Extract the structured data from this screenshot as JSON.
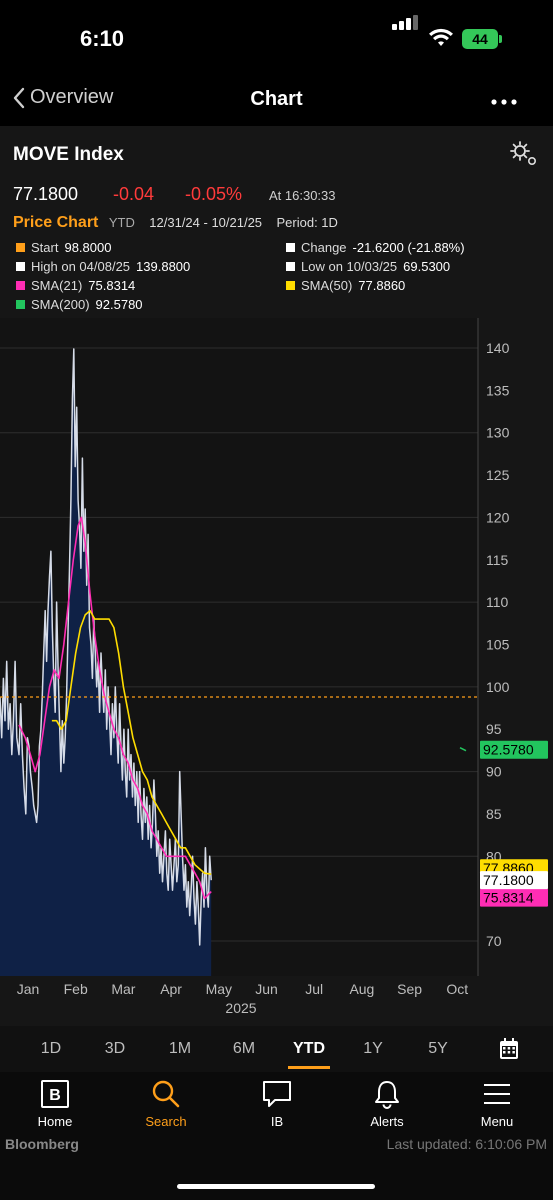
{
  "status_bar": {
    "time": "6:10",
    "battery": "44"
  },
  "nav": {
    "back_label": "Overview",
    "title": "Chart"
  },
  "security": {
    "name": "MOVE Index",
    "last": "77.1800",
    "change": "-0.04",
    "change_pct": "-0.05%",
    "time": "At 16:30:33"
  },
  "price_chart": {
    "title": "Price Chart",
    "range_type": "YTD",
    "date_range": "12/31/24 - 10/21/25",
    "period": "Period: 1D"
  },
  "legend": [
    {
      "label": "Start",
      "value": "98.8000",
      "color": "#ff9f1a"
    },
    {
      "label": "Change",
      "value": "-21.6200 (-21.88%)",
      "color": "#ffffff"
    },
    {
      "label": "High on 04/08/25",
      "value": "139.8800",
      "color": "#ffffff"
    },
    {
      "label": "Low on 10/03/25",
      "value": "69.5300",
      "color": "#ffffff"
    },
    {
      "label": "SMA(21)",
      "value": "75.8314",
      "color": "#ff2db4"
    },
    {
      "label": "SMA(50)",
      "value": "77.8860",
      "color": "#ffdd00"
    },
    {
      "label": "SMA(200)",
      "value": "92.5780",
      "color": "#22c55e"
    }
  ],
  "chart_data": {
    "type": "area",
    "ylim": [
      65,
      142
    ],
    "y_ticks": [
      "70",
      "75",
      "80",
      "85",
      "90",
      "95",
      "100",
      "105",
      "110",
      "115",
      "120",
      "125",
      "130",
      "135",
      "140"
    ],
    "x_ticks": [
      "Jan",
      "Feb",
      "Mar",
      "Apr",
      "May",
      "Jun",
      "Jul",
      "Aug",
      "Sep",
      "Oct"
    ],
    "x_year": "2025",
    "start_line": 98.8,
    "markers": [
      {
        "value": 92.578,
        "label": "92.5780",
        "bg": "#22c55e",
        "fg": "#000000"
      },
      {
        "value": 77.886,
        "label": "77.8860",
        "bg": "#ffdd00",
        "fg": "#000000"
      },
      {
        "value": 75.8314,
        "label": "75.8314",
        "bg": "#ff2db4",
        "fg": "#000000"
      },
      {
        "value": 77.18,
        "label": "77.1800",
        "bg": "#ffffff",
        "fg": "#000000"
      }
    ],
    "series": [
      {
        "name": "MOVE Index",
        "color": "#d6dce8",
        "fill": "#0f2146",
        "points": [
          [
            0,
            98.8
          ],
          [
            0.03,
            94
          ],
          [
            0.06,
            101
          ],
          [
            0.09,
            96
          ],
          [
            0.12,
            103
          ],
          [
            0.15,
            95
          ],
          [
            0.18,
            98
          ],
          [
            0.21,
            92
          ],
          [
            0.24,
            96
          ],
          [
            0.27,
            103
          ],
          [
            0.3,
            94
          ],
          [
            0.34,
            92
          ],
          [
            0.37,
            98
          ],
          [
            0.4,
            92
          ],
          [
            0.43,
            88
          ],
          [
            0.46,
            85
          ],
          [
            0.49,
            94
          ],
          [
            0.52,
            93
          ],
          [
            0.55,
            90
          ],
          [
            0.59,
            88
          ],
          [
            0.62,
            86
          ],
          [
            0.65,
            85
          ],
          [
            0.68,
            84
          ],
          [
            0.71,
            86
          ],
          [
            0.74,
            93
          ],
          [
            0.77,
            95
          ],
          [
            0.8,
            99
          ],
          [
            0.83,
            104
          ],
          [
            0.86,
            109
          ],
          [
            0.89,
            103
          ],
          [
            0.92,
            109
          ],
          [
            0.95,
            113
          ],
          [
            0.98,
            116
          ],
          [
            1.01,
            107
          ],
          [
            1.04,
            101
          ],
          [
            1.07,
            97
          ],
          [
            1.1,
            110
          ],
          [
            1.13,
            102
          ],
          [
            1.16,
            96
          ],
          [
            1.19,
            90
          ],
          [
            1.22,
            96
          ],
          [
            1.25,
            91
          ],
          [
            1.28,
            94
          ],
          [
            1.31,
            99
          ],
          [
            1.34,
            107
          ],
          [
            1.37,
            114
          ],
          [
            1.4,
            122
          ],
          [
            1.43,
            134
          ],
          [
            1.46,
            139.88
          ],
          [
            1.49,
            126
          ],
          [
            1.52,
            133
          ],
          [
            1.55,
            122
          ],
          [
            1.58,
            119
          ],
          [
            1.61,
            114
          ],
          [
            1.64,
            127
          ],
          [
            1.67,
            116
          ],
          [
            1.7,
            121
          ],
          [
            1.73,
            112
          ],
          [
            1.76,
            118
          ],
          [
            1.79,
            107
          ],
          [
            1.82,
            105
          ],
          [
            1.85,
            101
          ],
          [
            1.88,
            108
          ],
          [
            1.91,
            104
          ],
          [
            1.94,
            100
          ],
          [
            1.97,
            103
          ],
          [
            2.0,
            97
          ],
          [
            2.03,
            104
          ],
          [
            2.06,
            100
          ],
          [
            2.09,
            97
          ],
          [
            2.12,
            102
          ],
          [
            2.15,
            95
          ],
          [
            2.18,
            100
          ],
          [
            2.21,
            96
          ],
          [
            2.24,
            92
          ],
          [
            2.27,
            98
          ],
          [
            2.3,
            94
          ],
          [
            2.33,
            100
          ],
          [
            2.36,
            95
          ],
          [
            2.39,
            91
          ],
          [
            2.42,
            98
          ],
          [
            2.45,
            93
          ],
          [
            2.48,
            89
          ],
          [
            2.51,
            95
          ],
          [
            2.54,
            90
          ],
          [
            2.57,
            87
          ],
          [
            2.6,
            95
          ],
          [
            2.63,
            89
          ],
          [
            2.66,
            92
          ],
          [
            2.69,
            87
          ],
          [
            2.72,
            91
          ],
          [
            2.75,
            86
          ],
          [
            2.78,
            90
          ],
          [
            2.81,
            84
          ],
          [
            2.84,
            90
          ],
          [
            2.87,
            85
          ],
          [
            2.9,
            82
          ],
          [
            2.93,
            88
          ],
          [
            2.96,
            84
          ],
          [
            2.99,
            87
          ],
          [
            3.02,
            82
          ],
          [
            3.05,
            86
          ],
          [
            3.08,
            81
          ],
          [
            3.11,
            84
          ],
          [
            3.14,
            89
          ],
          [
            3.17,
            85
          ],
          [
            3.2,
            80
          ],
          [
            3.23,
            83
          ],
          [
            3.26,
            78
          ],
          [
            3.29,
            81
          ],
          [
            3.32,
            77
          ],
          [
            3.35,
            80
          ],
          [
            3.38,
            83
          ],
          [
            3.41,
            78
          ],
          [
            3.44,
            76
          ],
          [
            3.47,
            82
          ],
          [
            3.5,
            79
          ],
          [
            3.53,
            76
          ],
          [
            3.56,
            79
          ],
          [
            3.59,
            82
          ],
          [
            3.62,
            77
          ],
          [
            3.65,
            79
          ],
          [
            3.68,
            90
          ],
          [
            3.71,
            85
          ],
          [
            3.74,
            80
          ],
          [
            3.77,
            76
          ],
          [
            3.8,
            79
          ],
          [
            3.83,
            74
          ],
          [
            3.86,
            77
          ],
          [
            3.89,
            73
          ],
          [
            3.92,
            76
          ],
          [
            3.95,
            80
          ],
          [
            3.98,
            75
          ],
          [
            4.01,
            72
          ],
          [
            4.04,
            77
          ],
          [
            4.07,
            74
          ],
          [
            4.1,
            69.53
          ],
          [
            4.13,
            75
          ],
          [
            4.16,
            78
          ],
          [
            4.19,
            74
          ],
          [
            4.22,
            81
          ],
          [
            4.25,
            76
          ],
          [
            4.28,
            74
          ],
          [
            4.31,
            80
          ],
          [
            4.34,
            77.18
          ]
        ]
      },
      {
        "name": "SMA(21)",
        "color": "#ff2db4",
        "points": [
          [
            0.34,
            95.5
          ],
          [
            0.45,
            94
          ],
          [
            0.55,
            92
          ],
          [
            0.65,
            90
          ],
          [
            0.75,
            92
          ],
          [
            0.85,
            96
          ],
          [
            0.95,
            100
          ],
          [
            1.05,
            102
          ],
          [
            1.15,
            101
          ],
          [
            1.25,
            105
          ],
          [
            1.35,
            110
          ],
          [
            1.45,
            115
          ],
          [
            1.55,
            119
          ],
          [
            1.62,
            120
          ],
          [
            1.7,
            117
          ],
          [
            1.8,
            111
          ],
          [
            1.9,
            106
          ],
          [
            2.0,
            102
          ],
          [
            2.1,
            99
          ],
          [
            2.2,
            97
          ],
          [
            2.3,
            95
          ],
          [
            2.4,
            94
          ],
          [
            2.5,
            92
          ],
          [
            2.6,
            91
          ],
          [
            2.7,
            89
          ],
          [
            2.8,
            88
          ],
          [
            2.9,
            86
          ],
          [
            3.0,
            85
          ],
          [
            3.1,
            83
          ],
          [
            3.2,
            82
          ],
          [
            3.3,
            81
          ],
          [
            3.4,
            80
          ],
          [
            3.5,
            80
          ],
          [
            3.6,
            80
          ],
          [
            3.7,
            80
          ],
          [
            3.8,
            80
          ],
          [
            3.9,
            79
          ],
          [
            4.0,
            78
          ],
          [
            4.1,
            77
          ],
          [
            4.2,
            75
          ],
          [
            4.34,
            75.83
          ]
        ]
      },
      {
        "name": "SMA(50)",
        "color": "#ffdd00",
        "points": [
          [
            1.0,
            96
          ],
          [
            1.1,
            96
          ],
          [
            1.2,
            95
          ],
          [
            1.3,
            96
          ],
          [
            1.4,
            100
          ],
          [
            1.5,
            104
          ],
          [
            1.6,
            107
          ],
          [
            1.7,
            108.5
          ],
          [
            1.8,
            109
          ],
          [
            1.9,
            108
          ],
          [
            2.0,
            108
          ],
          [
            2.1,
            108
          ],
          [
            2.2,
            108
          ],
          [
            2.3,
            107
          ],
          [
            2.4,
            104
          ],
          [
            2.5,
            100
          ],
          [
            2.6,
            97
          ],
          [
            2.7,
            94
          ],
          [
            2.8,
            92
          ],
          [
            2.9,
            90
          ],
          [
            3.0,
            89
          ],
          [
            3.1,
            87
          ],
          [
            3.2,
            86
          ],
          [
            3.3,
            85
          ],
          [
            3.4,
            84
          ],
          [
            3.5,
            83
          ],
          [
            3.6,
            82
          ],
          [
            3.7,
            81
          ],
          [
            3.8,
            81
          ],
          [
            3.9,
            80
          ],
          [
            4.0,
            79
          ],
          [
            4.1,
            78.5
          ],
          [
            4.2,
            78
          ],
          [
            4.34,
            77.89
          ]
        ]
      }
    ]
  },
  "periods": [
    "1D",
    "3D",
    "1M",
    "6M",
    "YTD",
    "1Y",
    "5Y"
  ],
  "active_period": "YTD",
  "bottom_nav": [
    {
      "label": "Home",
      "icon": "home-icon"
    },
    {
      "label": "Search",
      "icon": "search-icon"
    },
    {
      "label": "IB",
      "icon": "chat-icon"
    },
    {
      "label": "Alerts",
      "icon": "bell-icon"
    },
    {
      "label": "Menu",
      "icon": "menu-icon"
    }
  ],
  "brand": "Bloomberg",
  "last_updated": "Last updated: 6:10:06 PM"
}
